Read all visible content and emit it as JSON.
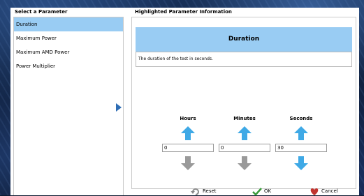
{
  "left_panel": {
    "title": "Select a Parameter",
    "items": [
      {
        "label": "Duration",
        "selected": true
      },
      {
        "label": "Maximum Power",
        "selected": false
      },
      {
        "label": "Maximum AMD Power",
        "selected": false
      },
      {
        "label": "Power Multiplier",
        "selected": false
      }
    ]
  },
  "right_panel": {
    "title": "Highlighted Parameter Information",
    "parameter_name": "Duration",
    "description": "The duration of the test in seconds.",
    "spinners": {
      "hours": {
        "label": "Hours",
        "value": "0"
      },
      "minutes": {
        "label": "Minutes",
        "value": "0"
      },
      "seconds": {
        "label": "Seconds",
        "value": "30"
      }
    }
  },
  "buttons": {
    "reset": "Reset",
    "ok": "OK",
    "cancel": "Cancel"
  },
  "colors": {
    "selection": "#99ccf3",
    "arrow_active": "#3fa9e6",
    "arrow_disabled": "#9a9a9a",
    "nav_arrow": "#2e6db4"
  },
  "icons": {
    "nav": "chevron-right-icon",
    "up": "arrow-up-icon",
    "down": "arrow-down-icon",
    "reset": "reset-icon",
    "ok": "checkmark-icon",
    "cancel": "cancel-icon"
  }
}
